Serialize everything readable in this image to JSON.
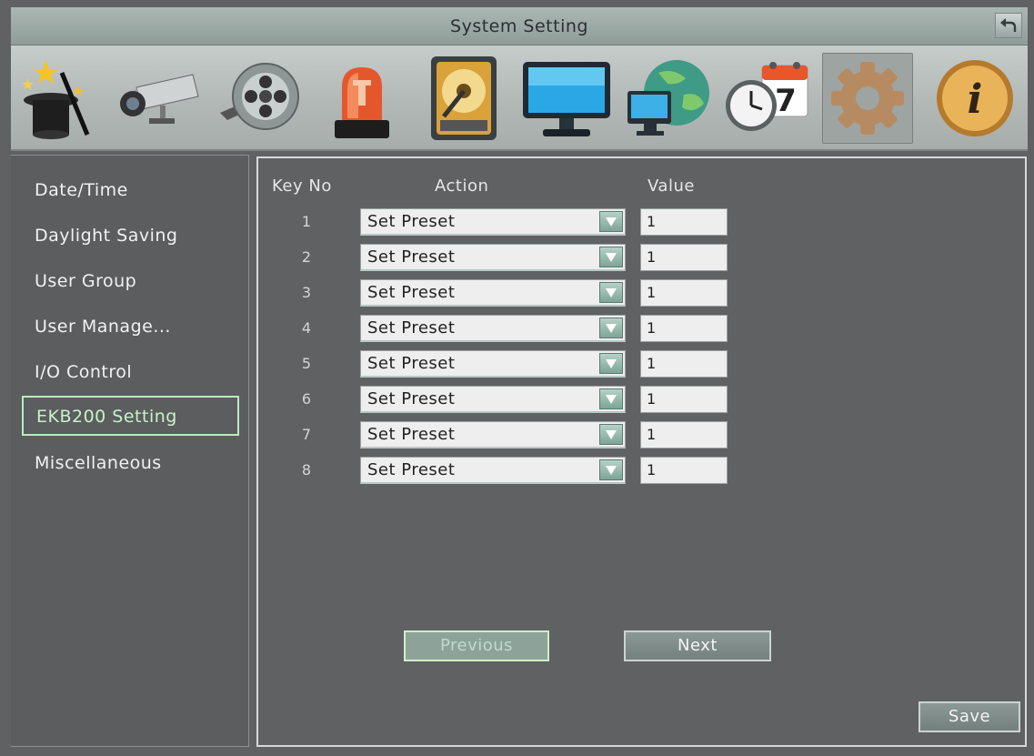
{
  "window": {
    "title": "System Setting"
  },
  "toolbar": {
    "icons": [
      "magic-wand-hat-icon",
      "camera-icon",
      "film-reel-icon",
      "alarm-light-icon",
      "hard-disk-icon",
      "monitor-icon",
      "network-globe-icon",
      "schedule-clock-icon",
      "gear-icon",
      "info-icon"
    ],
    "calendar_day": "7",
    "info_glyph": "i",
    "active_index": 8
  },
  "sidebar": {
    "items": [
      {
        "label": "Date/Time"
      },
      {
        "label": "Daylight Saving"
      },
      {
        "label": "User Group"
      },
      {
        "label": "User Manage..."
      },
      {
        "label": "I/O Control"
      },
      {
        "label": "EKB200 Setting"
      },
      {
        "label": "Miscellaneous"
      }
    ],
    "selected": "EKB200 Setting"
  },
  "table": {
    "headers": {
      "key_no": "Key No",
      "action": "Action",
      "value": "Value"
    },
    "rows": [
      {
        "key": "1",
        "action": "Set Preset",
        "value": "1"
      },
      {
        "key": "2",
        "action": "Set Preset",
        "value": "1"
      },
      {
        "key": "3",
        "action": "Set Preset",
        "value": "1"
      },
      {
        "key": "4",
        "action": "Set Preset",
        "value": "1"
      },
      {
        "key": "5",
        "action": "Set Preset",
        "value": "1"
      },
      {
        "key": "6",
        "action": "Set Preset",
        "value": "1"
      },
      {
        "key": "7",
        "action": "Set Preset",
        "value": "1"
      },
      {
        "key": "8",
        "action": "Set Preset",
        "value": "1"
      }
    ]
  },
  "buttons": {
    "previous": "Previous",
    "next": "Next",
    "save": "Save"
  },
  "colors": {
    "background": "#5f6163",
    "selected_outline": "#b9ecbe",
    "title_bar": "#9fadaa"
  }
}
